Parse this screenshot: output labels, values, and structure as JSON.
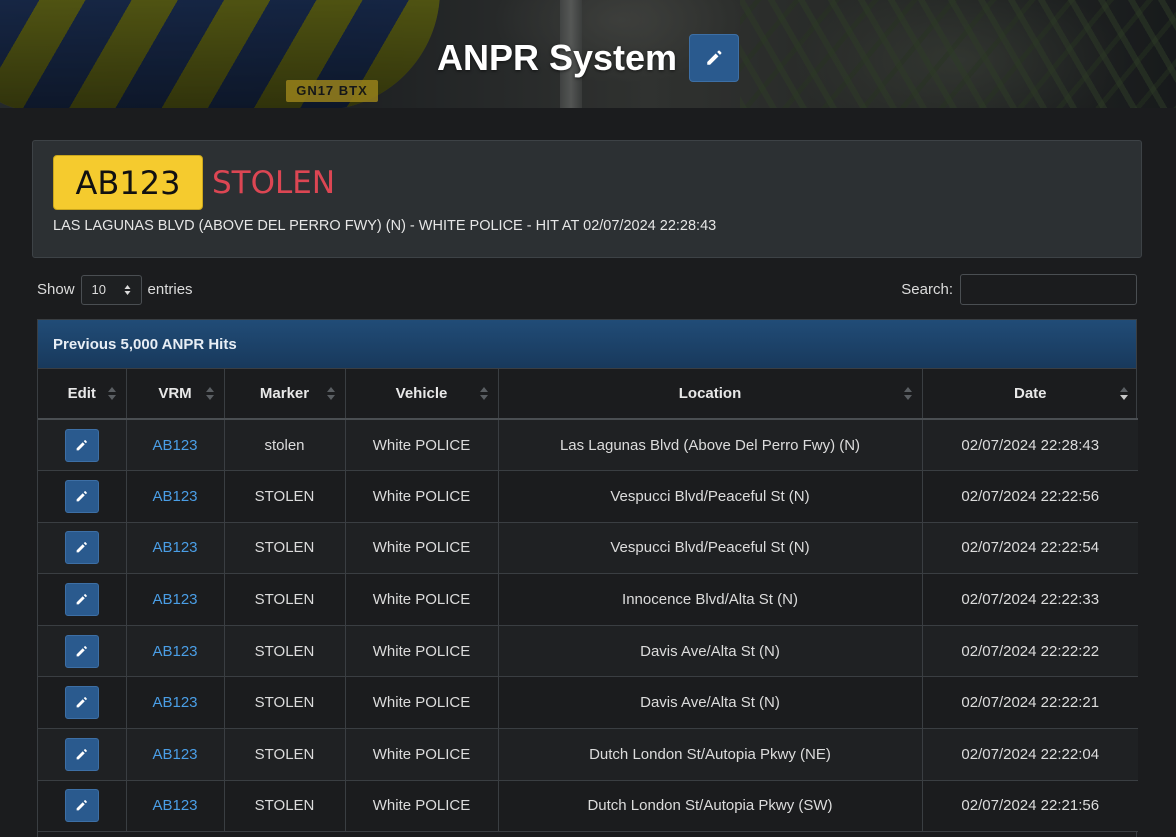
{
  "header": {
    "title": "ANPR System",
    "edit_icon": "pencil-icon",
    "banner_plate_text": "GN17 BTX"
  },
  "alert": {
    "plate": "AB123",
    "status": "STOLEN",
    "status_color": "#dc4653",
    "plate_color": "#f5cb2e",
    "hit_info": "LAS LAGUNAS BLVD (ABOVE DEL PERRO FWY) (N) - WHITE POLICE - HIT AT 02/07/2024 22:28:43"
  },
  "controls": {
    "show_label": "Show",
    "entries_value": "10",
    "entries_label": "entries",
    "search_label": "Search:",
    "search_value": ""
  },
  "panel": {
    "heading": "Previous 5,000 ANPR Hits",
    "accent": "#214c77"
  },
  "table": {
    "columns": [
      "Edit",
      "VRM",
      "Marker",
      "Vehicle",
      "Location",
      "Date"
    ],
    "sorted_column": "Date",
    "sort_direction": "desc",
    "rows": [
      {
        "vrm": "AB123",
        "marker": "stolen",
        "vehicle": "White POLICE",
        "location": "Las Lagunas Blvd (Above Del Perro Fwy) (N)",
        "date": "02/07/2024 22:28:43"
      },
      {
        "vrm": "AB123",
        "marker": "STOLEN",
        "vehicle": "White POLICE",
        "location": "Vespucci Blvd/Peaceful St (N)",
        "date": "02/07/2024 22:22:56"
      },
      {
        "vrm": "AB123",
        "marker": "STOLEN",
        "vehicle": "White POLICE",
        "location": "Vespucci Blvd/Peaceful St (N)",
        "date": "02/07/2024 22:22:54"
      },
      {
        "vrm": "AB123",
        "marker": "STOLEN",
        "vehicle": "White POLICE",
        "location": "Innocence Blvd/Alta St (N)",
        "date": "02/07/2024 22:22:33"
      },
      {
        "vrm": "AB123",
        "marker": "STOLEN",
        "vehicle": "White POLICE",
        "location": "Davis Ave/Alta St (N)",
        "date": "02/07/2024 22:22:22"
      },
      {
        "vrm": "AB123",
        "marker": "STOLEN",
        "vehicle": "White POLICE",
        "location": "Davis Ave/Alta St (N)",
        "date": "02/07/2024 22:22:21"
      },
      {
        "vrm": "AB123",
        "marker": "STOLEN",
        "vehicle": "White POLICE",
        "location": "Dutch London St/Autopia Pkwy (NE)",
        "date": "02/07/2024 22:22:04"
      },
      {
        "vrm": "AB123",
        "marker": "STOLEN",
        "vehicle": "White POLICE",
        "location": "Dutch London St/Autopia Pkwy (SW)",
        "date": "02/07/2024 22:21:56"
      }
    ]
  }
}
